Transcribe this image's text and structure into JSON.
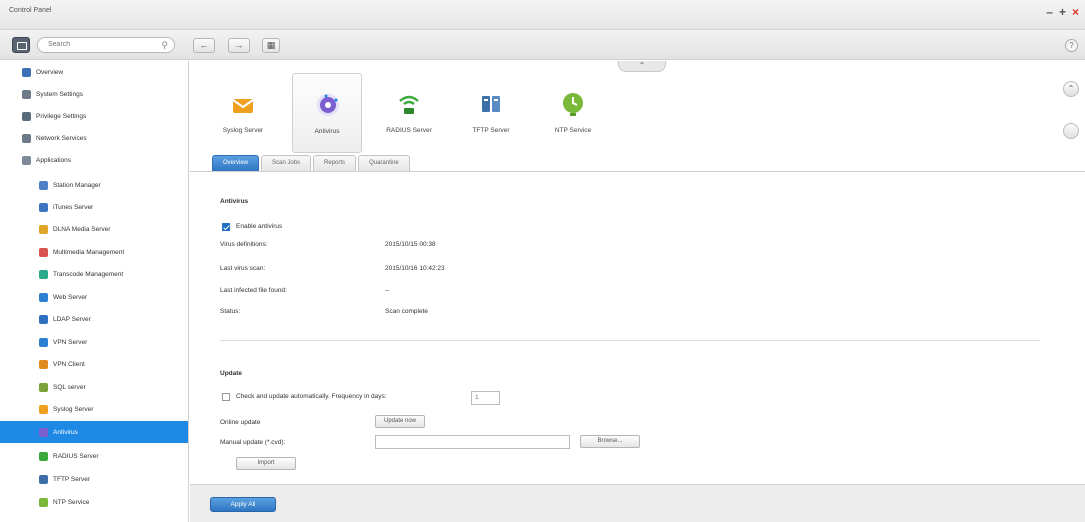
{
  "window": {
    "title": "Control Panel"
  },
  "toolbar": {
    "search_placeholder": "Search",
    "help": "?"
  },
  "sidebar": {
    "items": [
      {
        "label": "Overview",
        "color": "#3b6fb6"
      },
      {
        "label": "System Settings",
        "color": "#6c7a89"
      },
      {
        "label": "Privilege Settings",
        "color": "#5a6b7c"
      },
      {
        "label": "Network Services",
        "color": "#6c7a89"
      },
      {
        "label": "Applications",
        "color": "#7d8b99"
      },
      {
        "label": "Station Manager",
        "color": "#4f7fc7"
      },
      {
        "label": "iTunes Server",
        "color": "#3d75c0"
      },
      {
        "label": "DLNA Media Server",
        "color": "#e0a42a"
      },
      {
        "label": "Multimedia Management",
        "color": "#d9534f"
      },
      {
        "label": "Transcode Management",
        "color": "#2aa88a"
      },
      {
        "label": "Web Server",
        "color": "#2e7fd1"
      },
      {
        "label": "LDAP Server",
        "color": "#2e6fbf"
      },
      {
        "label": "VPN Server",
        "color": "#2e7fd1"
      },
      {
        "label": "VPN Client",
        "color": "#e08a1e"
      },
      {
        "label": "SQL server",
        "color": "#7aa23a"
      },
      {
        "label": "Syslog Server",
        "color": "#f0a020"
      },
      {
        "label": "Antivirus",
        "color": "#7b5fd0"
      },
      {
        "label": "RADIUS Server",
        "color": "#3aa83a"
      },
      {
        "label": "TFTP Server",
        "color": "#3f6fa8"
      },
      {
        "label": "NTP Service",
        "color": "#7ab83a"
      }
    ],
    "active": "Antivirus"
  },
  "apps": [
    {
      "label": "Syslog Server",
      "icon": "syslog-icon"
    },
    {
      "label": "Antivirus",
      "icon": "antivirus-icon"
    },
    {
      "label": "RADIUS Server",
      "icon": "radius-icon"
    },
    {
      "label": "TFTP Server",
      "icon": "tftp-icon"
    },
    {
      "label": "NTP Service",
      "icon": "ntp-icon"
    }
  ],
  "tabs": [
    "Overview",
    "Scan Jobs",
    "Reports",
    "Quarantine"
  ],
  "antivirus": {
    "section_title": "Antivirus",
    "enable_label": "Enable antivirus",
    "enabled": true,
    "rows": [
      {
        "label": "Virus definitions:",
        "value": "2015/10/15 00:38"
      },
      {
        "label": "Last virus scan:",
        "value": "2015/10/16 10:42:23"
      },
      {
        "label": "Last infected file found:",
        "value": "--"
      },
      {
        "label": "Status:",
        "value": "Scan complete"
      }
    ]
  },
  "update": {
    "section_title": "Update",
    "auto_label": "Check and update automatically. Frequency in days:",
    "auto_checked": false,
    "frequency": "1",
    "online_label": "Online update",
    "update_now": "Update now",
    "manual_label": "Manual update (*.cvd):",
    "browse": "Browse...",
    "import": "Import"
  },
  "footer": {
    "apply_all": "Apply All"
  }
}
